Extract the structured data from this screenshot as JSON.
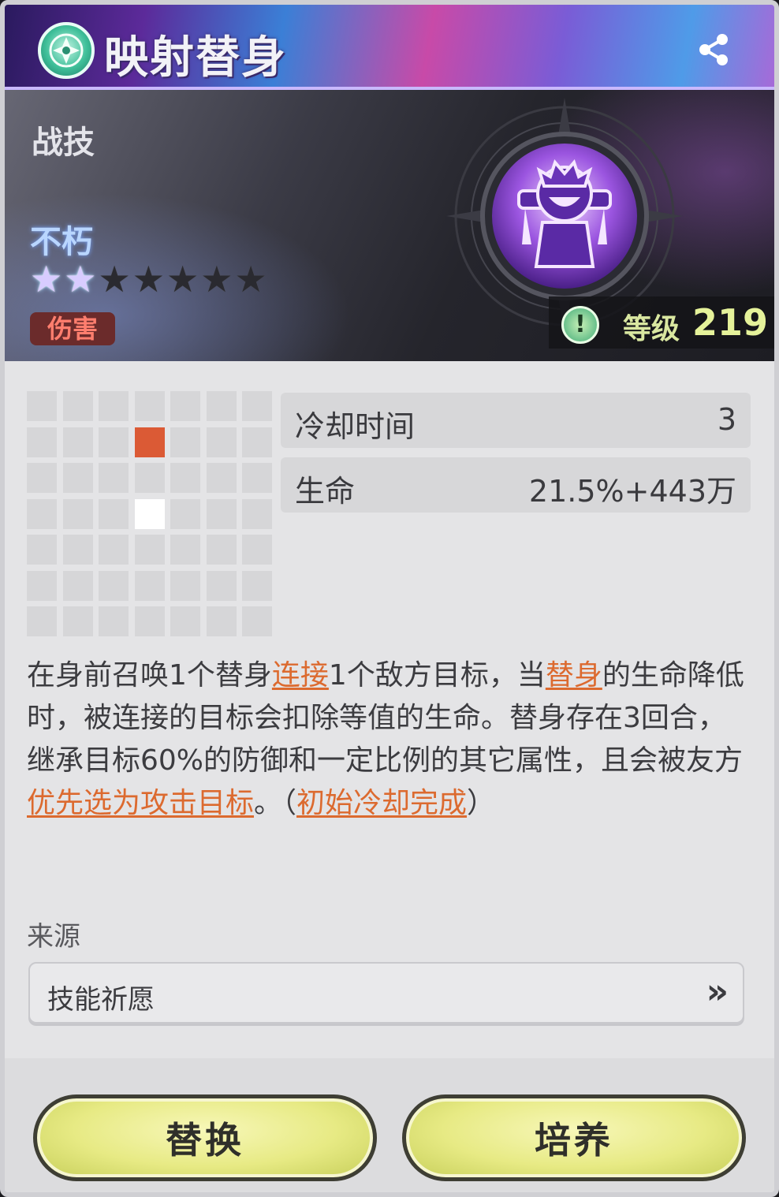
{
  "title": {
    "name": "映射替身"
  },
  "header": {
    "skill_type": "战技",
    "tag_name": "不朽",
    "stars": {
      "filled": 2,
      "total": 7
    },
    "damage_badge": "伤害",
    "level_label": "等级",
    "level_value": "219"
  },
  "range_grid": {
    "rows": 7,
    "cols": 7,
    "hit_cells": [
      [
        1,
        3
      ]
    ],
    "self_cells": [
      [
        3,
        3
      ]
    ]
  },
  "stats": [
    {
      "label": "冷却时间",
      "value": "3"
    },
    {
      "label": "生命",
      "value": "21.5%+443万"
    }
  ],
  "description": {
    "segments": [
      {
        "text": "在身前召唤1个替身",
        "kw": false
      },
      {
        "text": "连接",
        "kw": true
      },
      {
        "text": "1个敌方目标，当",
        "kw": false
      },
      {
        "text": "替身",
        "kw": true
      },
      {
        "text": "的生命降低时，被连接的目标会扣除等值的生命。替身存在3回合，继承目标60%的防御和一定比例的其它属性，且会被友方",
        "kw": false
      },
      {
        "text": "优先选为攻击目标",
        "kw": true
      },
      {
        "text": "。（",
        "kw": false
      },
      {
        "text": "初始冷却完成",
        "kw": true
      },
      {
        "text": "）",
        "kw": false
      }
    ]
  },
  "source": {
    "label": "来源",
    "value": "技能祈愿",
    "arrow": "»"
  },
  "buttons": {
    "replace": "替换",
    "train": "培养"
  },
  "colors": {
    "keyword": "#dc6a2f",
    "hit_cell": "#db5a35",
    "button": "#e7ea84"
  }
}
